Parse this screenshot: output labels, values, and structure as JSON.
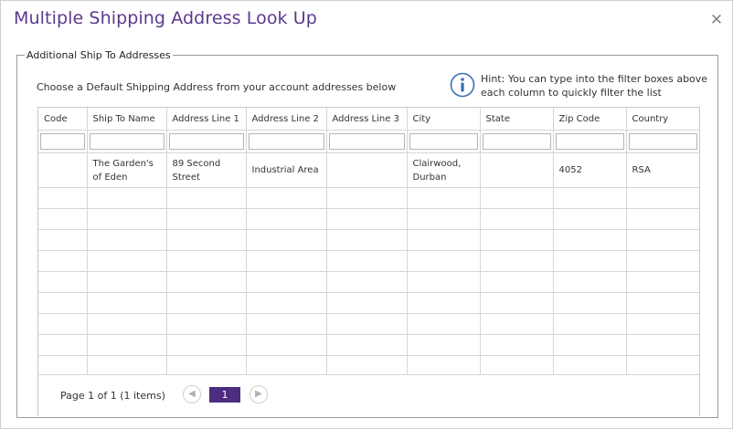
{
  "dialog": {
    "title": "Multiple Shipping Address Look Up",
    "close_icon": "close-icon"
  },
  "group": {
    "legend": "Additional Ship To Addresses",
    "instruction": "Choose a Default Shipping Address from your account addresses below",
    "hint_icon": "info-icon",
    "hint": "Hint: You can type into the filter boxes above each column to quickly filter the list"
  },
  "grid": {
    "columns": [
      "Code",
      "Ship To Name",
      "Address Line 1",
      "Address Line 2",
      "Address Line 3",
      "City",
      "State",
      "Zip Code",
      "Country"
    ],
    "rows": [
      {
        "code": "",
        "ship_to_name": "The Garden's of Eden",
        "address1": "89 Second Street",
        "address2": "Industrial Area",
        "address3": "",
        "city": "Clairwood, Durban",
        "state": "",
        "zip": "4052",
        "country": "RSA"
      }
    ],
    "filters": [
      "",
      "",
      "",
      "",
      "",
      "",
      "",
      "",
      ""
    ]
  },
  "pager": {
    "info": "Page 1 of 1 (1 items)",
    "current_page": "1",
    "prev_icon": "chevron-left-icon",
    "next_icon": "chevron-right-icon"
  },
  "colors": {
    "title": "#5b3a8c",
    "pager_active": "#4d2d7f",
    "hint_icon": "#3a6fb0"
  }
}
